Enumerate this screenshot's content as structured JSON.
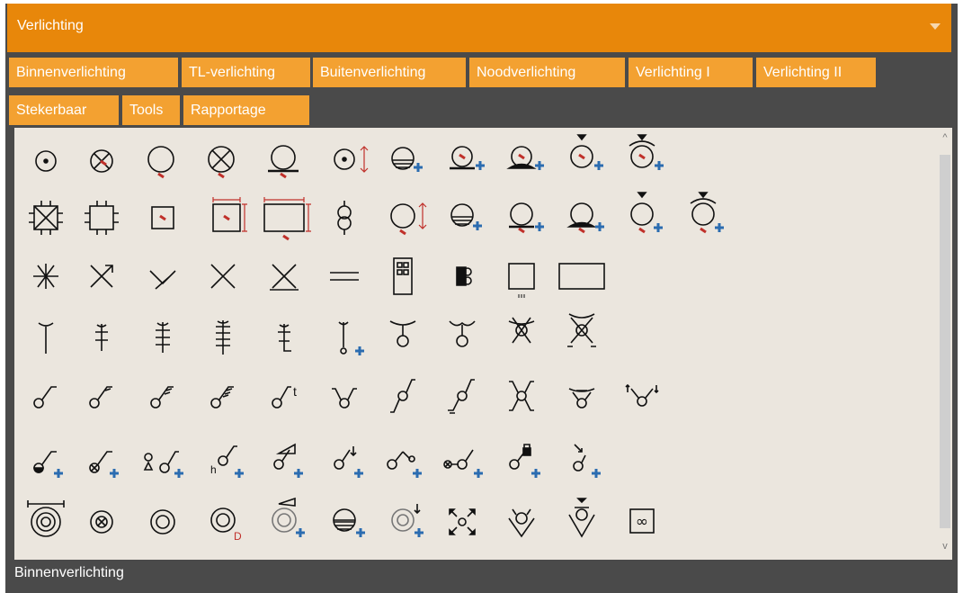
{
  "panel": {
    "title": "Verlichting",
    "collapse_icon": "chevron-down-icon"
  },
  "tabs": [
    {
      "label": "Binnenverlichting",
      "active": true
    },
    {
      "label": "TL-verlichting"
    },
    {
      "label": "Buitenverlichting"
    },
    {
      "label": "Noodverlichting"
    },
    {
      "label": "Verlichting I"
    },
    {
      "label": "Verlichting II"
    },
    {
      "label": "Stekerbaar"
    },
    {
      "label": "Tools"
    },
    {
      "label": "Rapportage"
    }
  ],
  "symbol_labels": {
    "d_label": "D",
    "t_label": "t",
    "h_label": "h",
    "infinity_label": "∞"
  },
  "status": {
    "text": "Binnenverlichting"
  },
  "colors": {
    "header": "#e8870a",
    "tab": "#f3a131",
    "panel": "#4a4a4a",
    "canvas": "#ebe6de",
    "accent_plus": "#2b6cb0",
    "accent_red": "#c0302a"
  }
}
